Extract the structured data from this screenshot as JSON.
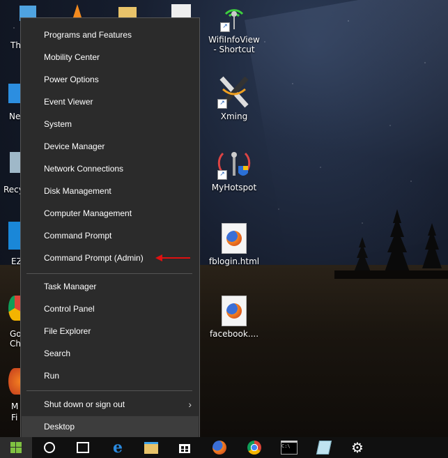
{
  "winx_menu": {
    "items": [
      {
        "label": "Programs and Features"
      },
      {
        "label": "Mobility Center"
      },
      {
        "label": "Power Options"
      },
      {
        "label": "Event Viewer"
      },
      {
        "label": "System"
      },
      {
        "label": "Device Manager"
      },
      {
        "label": "Network Connections"
      },
      {
        "label": "Disk Management"
      },
      {
        "label": "Computer Management"
      },
      {
        "label": "Command Prompt"
      },
      {
        "label": "Command Prompt (Admin)"
      },
      {
        "label": "Task Manager"
      },
      {
        "label": "Control Panel"
      },
      {
        "label": "File Explorer"
      },
      {
        "label": "Search"
      },
      {
        "label": "Run"
      },
      {
        "label": "Shut down or sign out",
        "has_submenu": true
      },
      {
        "label": "Desktop",
        "highlighted": true
      }
    ]
  },
  "desktop_icons": [
    {
      "label": "WifiInfoView - Shortcut",
      "icon": "wifi-signal-icon"
    },
    {
      "label": "Xming",
      "icon": "x-logo-icon"
    },
    {
      "label": "MyHotspot",
      "icon": "hotspot-antenna-icon"
    },
    {
      "label": "fblogin.html",
      "icon": "firefox-document-icon"
    },
    {
      "label": "facebook....",
      "icon": "firefox-document-icon"
    }
  ],
  "left_edge_labels": [
    "Th",
    "Ne",
    "Recy",
    "EZ",
    "Go",
    "Ch",
    "M",
    "Fi"
  ],
  "taskbar_icons": [
    "windows-start-icon",
    "cortana-circle-icon",
    "task-view-icon",
    "edge-icon",
    "file-explorer-icon",
    "store-icon",
    "firefox-icon",
    "chrome-icon",
    "cmd-icon",
    "notepad-icon",
    "settings-gear-icon"
  ],
  "colors": {
    "menu_bg": "#2b2b2b",
    "menu_highlight": "#3d3d3d",
    "annotation_arrow": "#e01010"
  }
}
